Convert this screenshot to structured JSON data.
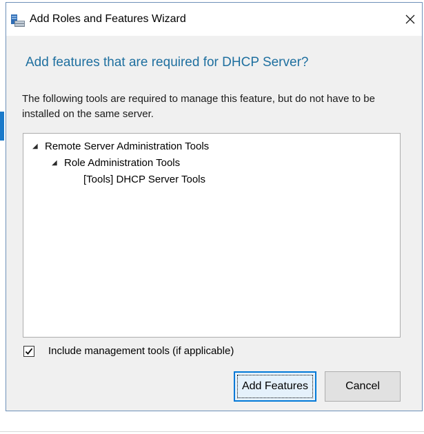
{
  "window": {
    "title": "Add Roles and Features Wizard",
    "icon": "server-manager-icon",
    "close_icon": "close-icon"
  },
  "dialog": {
    "heading": "Add features that are required for DHCP Server?",
    "description": "The following tools are required to manage this feature, but do not have to be installed on the same server.",
    "tree": [
      {
        "label": "Remote Server Administration Tools",
        "level": 0,
        "expanded": true
      },
      {
        "label": "Role Administration Tools",
        "level": 1,
        "expanded": true
      },
      {
        "label": "[Tools] DHCP Server Tools",
        "level": 2,
        "expanded": false
      }
    ],
    "include_tools": {
      "label": "Include management tools (if applicable)",
      "checked": true
    },
    "buttons": {
      "add_features": "Add Features",
      "cancel": "Cancel"
    }
  },
  "colors": {
    "heading": "#1e6f9f",
    "primary_button_border": "#0078d7",
    "primary_button_fill": "#e5f1fb",
    "dialog_background": "#f0f0f0"
  }
}
